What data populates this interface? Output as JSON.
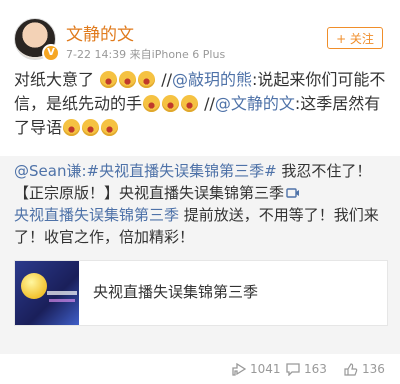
{
  "author": {
    "name": "文静的文",
    "meta": "7-22 14:39  来自iPhone 6 Plus",
    "follow_label": "+ 关注",
    "verified_badge": "V"
  },
  "post": {
    "p1": "对纸大意了",
    "p2": " //",
    "mention1": "@敲玥的熊",
    "p3": ":说起来你们可能不信，是纸先动的手",
    "p4": " //",
    "mention2": "@文静的文",
    "p5": ":这季居然有了导语"
  },
  "repost": {
    "mention": "@Sean谦",
    "topic1": ":#央视直播失误集锦第三季#",
    "t1": " 我忍不住了！【正宗原版！】央视直播失误集锦第三季",
    "topic2": "央视直播失误集锦第三季",
    "t2": " 提前放送，不用等了！我们来了！收官之作，倍加精彩！",
    "card_title": "央视直播失误集锦第三季"
  },
  "actions": {
    "repost_count": "1041",
    "comment_count": "163",
    "like_count": "136"
  },
  "colors": {
    "link": "#4e72a8",
    "name": "#e07b1d",
    "follow": "#f08e2a"
  }
}
